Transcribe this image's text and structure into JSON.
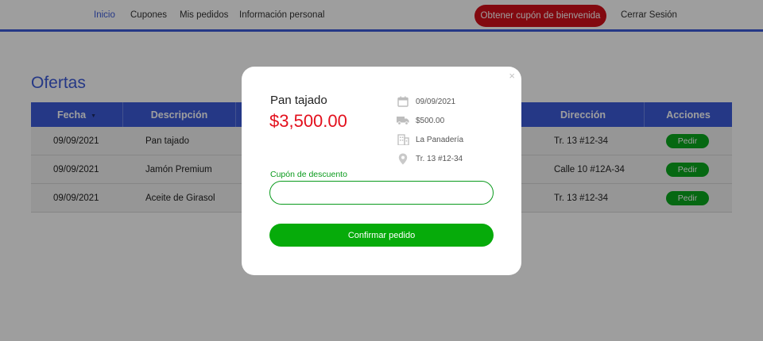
{
  "nav": {
    "links": [
      "Inicio",
      "Cupones",
      "Mis pedidos",
      "Información personal"
    ],
    "coupon_button": "Obtener cupón de bienvenida",
    "logout": "Cerrar Sesión",
    "accent_color": "#3d5bd9",
    "coupon_color": "#d20f1a"
  },
  "page": {
    "title": "Ofertas",
    "table": {
      "headers": [
        "Fecha",
        "Descripción",
        "Dirección",
        "Acciones"
      ],
      "sort_icon": "caret-down-icon",
      "rows": [
        {
          "date": "09/09/2021",
          "description": "Pan tajado",
          "address": "Tr. 13 #12-34",
          "action": "Pedir"
        },
        {
          "date": "09/09/2021",
          "description": "Jamón Premium",
          "address": "Calle 10 #12A-34",
          "action": "Pedir"
        },
        {
          "date": "09/09/2021",
          "description": "Aceite de Girasol",
          "address": "Tr. 13 #12-34",
          "action": "Pedir"
        }
      ]
    }
  },
  "modal": {
    "close": "×",
    "product_name": "Pan tajado",
    "price": "$3,500.00",
    "price_color": "#e3101d",
    "info": [
      {
        "icon": "calendar-icon",
        "text": "09/09/2021"
      },
      {
        "icon": "truck-icon",
        "text": "$500.00"
      },
      {
        "icon": "building-icon",
        "text": "La Panadería"
      },
      {
        "icon": "location-pin-icon",
        "text": "Tr. 13 #12-34"
      }
    ],
    "coupon_label": "Cupón de descuento",
    "coupon_value": "",
    "confirm_button": "Confirmar pedido",
    "confirm_color": "#06ab0a"
  }
}
